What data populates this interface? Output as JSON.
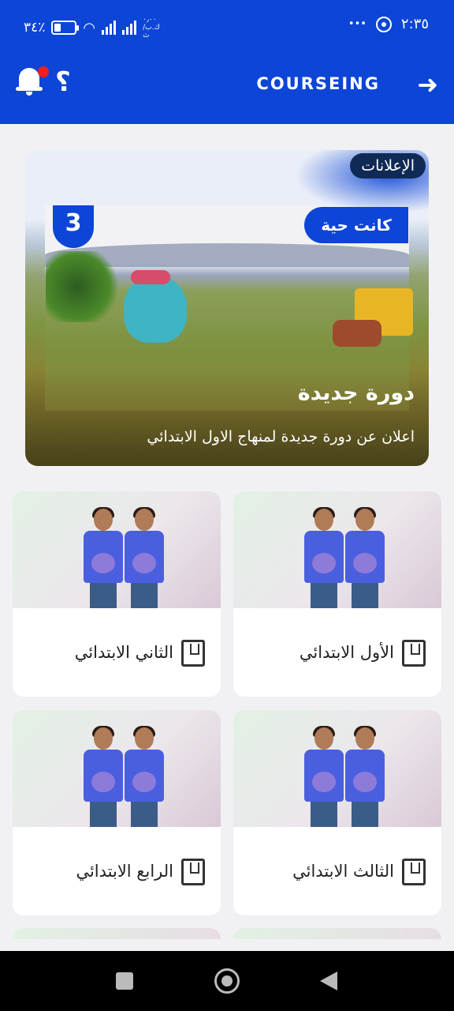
{
  "status_bar": {
    "battery": "٣٤٪",
    "battery_level": 0.34,
    "network_speed": "٠٫٠٠ ك.ب/ث",
    "time": "٢:٣٥",
    "more": "•••"
  },
  "header": {
    "logo": "COURSEING",
    "back_arrow": "➜",
    "help": "؟",
    "notification_dot": true,
    "colors": {
      "primary": "#0d45d6",
      "notification": "#f01e1e"
    }
  },
  "announcement": {
    "badge": "الإعلانات",
    "live_tag": "كانت حية",
    "episode_number": "3",
    "title": "دورة جديدة",
    "description": "اعلان عن دورة جديدة لمنهاج الاول الابتدائي"
  },
  "grades": [
    {
      "label": "الأول الابتدائي"
    },
    {
      "label": "الثاني الابتدائي"
    },
    {
      "label": "الثالث الابتدائي"
    },
    {
      "label": "الرابع الابتدائي"
    }
  ],
  "icons": {
    "book": "book-icon",
    "bell": "bell-icon",
    "help": "help-icon",
    "back": "arrow-right-icon"
  }
}
